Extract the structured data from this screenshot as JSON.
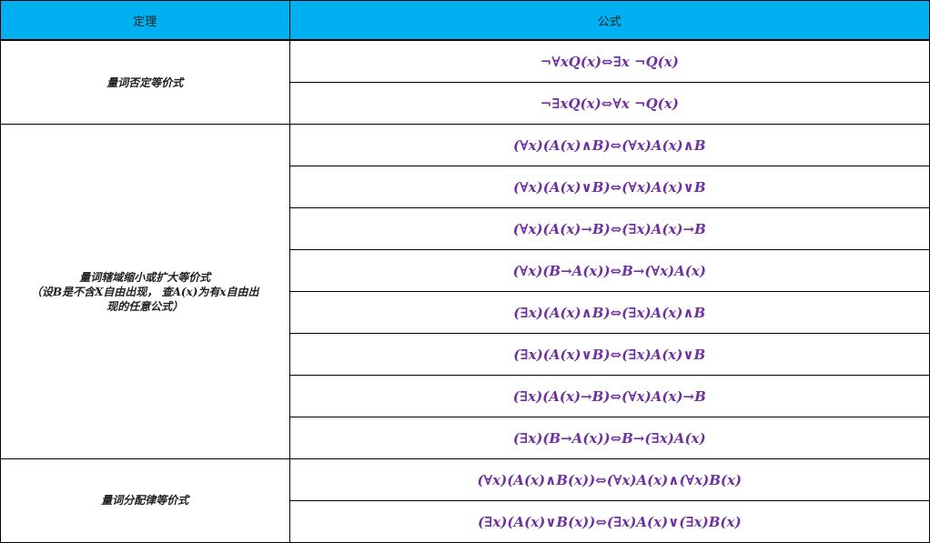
{
  "header": {
    "theorem_label": "定理",
    "formula_label": "公式"
  },
  "groups": [
    {
      "theorem_lines": [
        "量词否定等价式"
      ],
      "formulas": [
        "¬∀xQ(x)⇔∃x ¬Q(x)",
        "¬∃xQ(x)⇔∀x ¬Q(x)"
      ]
    },
    {
      "theorem_lines": [
        "量词辖域缩小或扩大等价式",
        "（设B是不含X自由出现， 查A(x)为有x自由出",
        "现的任意公式）"
      ],
      "formulas": [
        "(∀x)(A(x)∧B)⇔(∀x)A(x)∧B",
        "(∀x)(A(x)∨B)⇔(∀x)A(x)∨B",
        "(∀x)(A(x)→B)⇔(∃x)A(x)→B",
        "(∀x)(B→A(x))⇔B→(∀x)A(x)",
        "(∃x)(A(x)∧B)⇔(∃x)A(x)∧B",
        "(∃x)(A(x)∨B)⇔(∃x)A(x)∨B",
        "(∃x)(A(x)→B)⇔(∀x)A(x)→B",
        "(∃x)(B→A(x))⇔B→(∃x)A(x)"
      ]
    },
    {
      "theorem_lines": [
        "量词分配律等价式"
      ],
      "formulas": [
        "(∀x)(A(x)∧B(x))⇔(∀x)A(x)∧(∀x)B(x)",
        "(∃x)(A(x)∨B(x))⇔(∃x)A(x)∨(∃x)B(x)"
      ]
    }
  ],
  "colors": {
    "header_bg": "#00b0f0",
    "formula_text": "#7030a0",
    "theorem_text": "#222222"
  }
}
